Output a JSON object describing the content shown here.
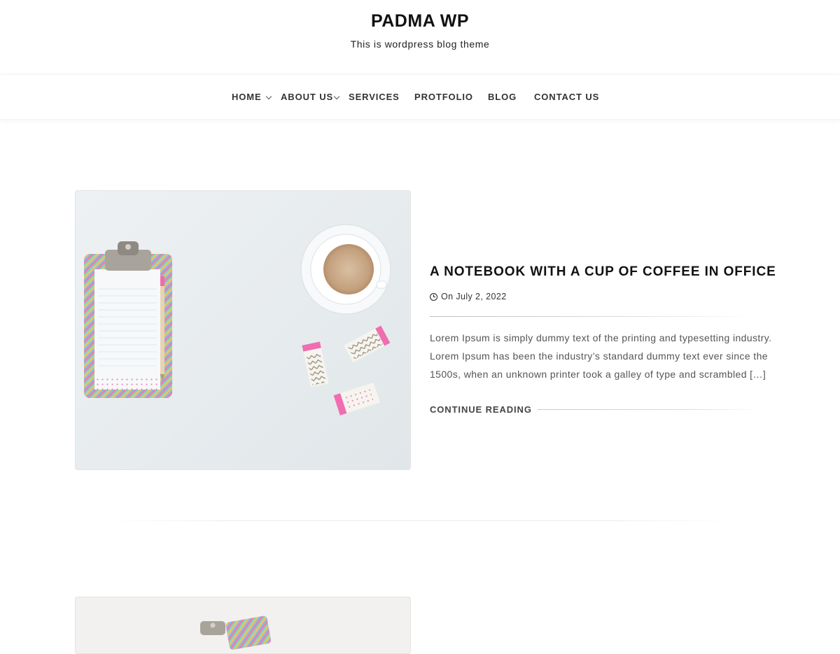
{
  "site": {
    "title": "PADMA WP",
    "description": "This is wordpress blog theme"
  },
  "nav": {
    "items": [
      {
        "label": "HOME",
        "has_submenu": true
      },
      {
        "label": "ABOUT US",
        "has_submenu": true
      },
      {
        "label": "SERVICES",
        "has_submenu": false
      },
      {
        "label": "PROTFOLIO",
        "has_submenu": false
      },
      {
        "label": "BLOG",
        "has_submenu": false
      },
      {
        "label": "CONTACT US",
        "has_submenu": false
      }
    ]
  },
  "posts": [
    {
      "title": "A NOTEBOOK WITH A CUP OF COFFEE IN OFFICE",
      "meta_icon": "clock-icon",
      "date": "On July 2, 2022",
      "excerpt_lines": [
        "Lorem Ipsum is simply dummy text of the printing and typesetting industry.",
        "Lorem Ipsum has been the industry’s standard dummy text ever since the",
        "1500s, when an unknown printer took a galley of type and scrambled […]"
      ],
      "continue_label": "CONTINUE READING",
      "image_semantic": "clipboard-coffee-erasers-photo"
    },
    {
      "image_semantic": "clipboard-photo"
    }
  ],
  "colors": {
    "accent_text": "#111111",
    "body_text": "#555555",
    "divider": "#dcdcdc"
  }
}
